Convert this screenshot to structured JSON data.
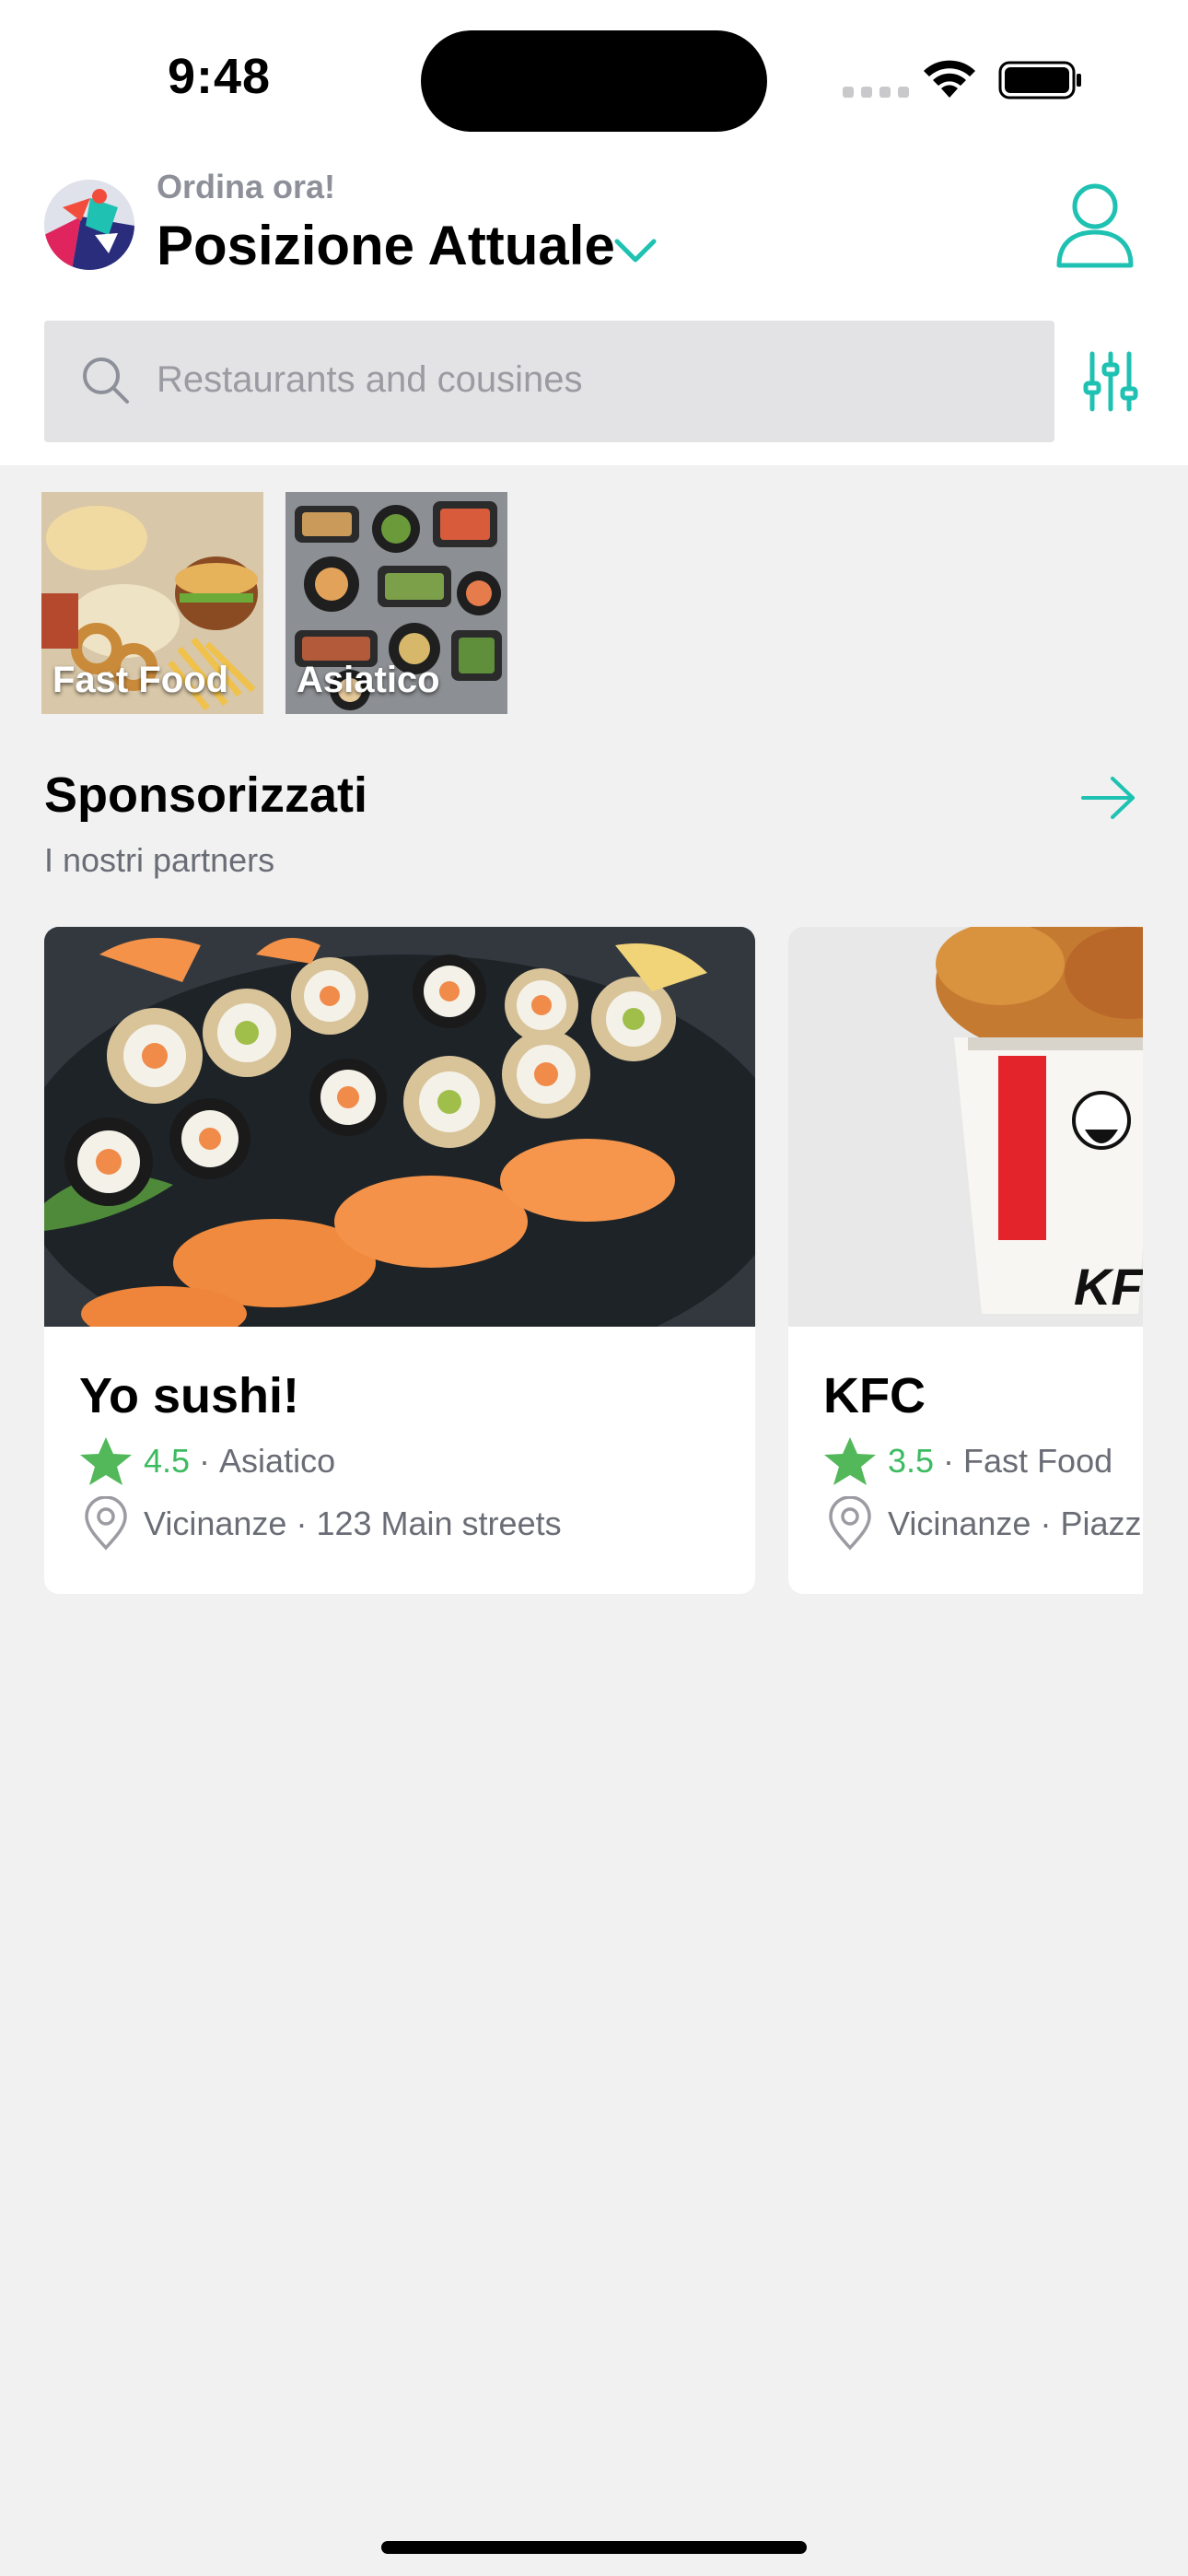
{
  "status_bar": {
    "time": "9:48"
  },
  "header": {
    "eyebrow": "Ordina ora!",
    "location": "Posizione Attuale",
    "accent_color": "#1fc2b2"
  },
  "search": {
    "placeholder": "Restaurants and cousines"
  },
  "categories": [
    {
      "label": "Fast Food"
    },
    {
      "label": "Asiatico"
    }
  ],
  "section": {
    "title": "Sponsorizzati",
    "subtitle": "I nostri partners"
  },
  "restaurants": [
    {
      "name": "Yo sushi!",
      "rating": "4.5",
      "dot": "·",
      "category": "Asiatico",
      "distance": "Vicinanze",
      "address": "123 Main streets"
    },
    {
      "name": "KFC",
      "rating": "3.5",
      "dot": "·",
      "category": "Fast Food",
      "distance": "Vicinanze",
      "address": "Piazz"
    }
  ],
  "icons": [
    "avatar-logo-icon",
    "chevron-down-icon",
    "user-icon",
    "search-icon",
    "filter-sliders-icon",
    "arrow-right-icon",
    "star-icon",
    "location-pin-icon",
    "wifi-icon",
    "battery-icon"
  ]
}
